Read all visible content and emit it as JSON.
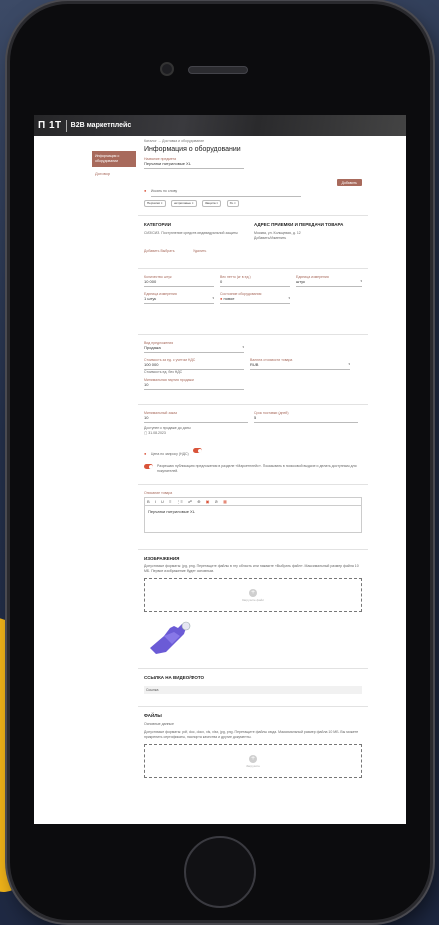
{
  "topbar": {
    "logo": "П 1Т",
    "brand": "B2B маркетплейс"
  },
  "sidebar": {
    "active_item": "Информация о оборудовании",
    "item_2": "Договор"
  },
  "breadcrumb": "Каталог  →  Доставка и оборудование",
  "page": {
    "title": "Информация о оборудовании",
    "name_label": "Название предмета",
    "name_value": "Перчатки нитриловые XL"
  },
  "search": {
    "placeholder": "Искать по слову",
    "button": "Добавить",
    "tags": [
      "Перчатки ×",
      "нитриловые ×",
      "Защита ×",
      "XL ×"
    ]
  },
  "category": {
    "title": "КАТЕГОРИИ",
    "text": "СИЗ/СИЗ. Поступление средств индивидуальной защиты",
    "add_link": "Добавить Выбрать",
    "delete_link": "Удалить"
  },
  "address": {
    "title": "АДРЕС ПРИЕМКИ И ПЕРЕДАЧИ ТОВАРА",
    "text": "Москва, ул. Кольцевая, д. 12",
    "link": "Добавить/Изменить"
  },
  "params": {
    "f1_label": "Количество штук",
    "f1_value": "10 000",
    "f2_label": "Вес нетто (кг в ед.)",
    "f2_value": "0",
    "f3_label": "Единица измерения",
    "f3_value": "штук",
    "f4_label": "Единица измерения",
    "f4_value": "1 штук",
    "f5_label": "Состояние оборудования",
    "f5_value": "новое"
  },
  "price": {
    "f1_label": "Вид предложения",
    "f1_value": "Продажа",
    "f2_label": "Стоимость за ед. с учетом НДС",
    "f2_value": "100 000",
    "f2_note": "Стоимость ед. без НДС",
    "f3_label": "Валюта стоимости товара",
    "f3_value": "RUB",
    "f4_label": "Минимальная партия продажи",
    "f4_value": "10"
  },
  "stock": {
    "f1_label": "Минимальный заказ",
    "f1_value": "10",
    "f2_label": "Срок поставки (дней)",
    "f2_value": "5",
    "date_label": "Доступен к продаже до даты",
    "date_value": "31.08.2023",
    "toggle1_label": "Цена по запросу (НДС)",
    "toggle2_text": "Разрешаю публикацию предложения в разделе «Маркетплейс». Показывать в поисковой выдаче и делать доступным для покупателей."
  },
  "description": {
    "label": "Описание товара",
    "toolbar": [
      "B",
      "I",
      "U",
      "≡",
      "⋮≡",
      "☍",
      "⊕",
      "▣",
      "⊘",
      "▦"
    ],
    "text": "Перчатки нитриловые XL"
  },
  "images": {
    "title": "ИЗОБРАЖЕНИЯ",
    "hint": "Допустимые форматы: jpg, png. Перетащите файлы в эту область или нажмите «Выбрать файл». Максимальный размер файла 10 МБ. Первое изображение будет основным.",
    "drop_text": "Загрузите файл"
  },
  "video": {
    "title": "ССЫЛКА НА ВИДЕО/ФОТО",
    "placeholder": "Ссылка"
  },
  "files": {
    "title": "ФАЙЛЫ",
    "sub": "Основные данные",
    "hint": "Допустимые форматы: pdf, doc, docx, xls, xlsx, jpg, png. Перетащите файлы сюда. Максимальный размер файла 10 МБ. Вы можете прикрепить сертификаты, паспорта качества и другие документы.",
    "drop_text": "Загрузите"
  }
}
